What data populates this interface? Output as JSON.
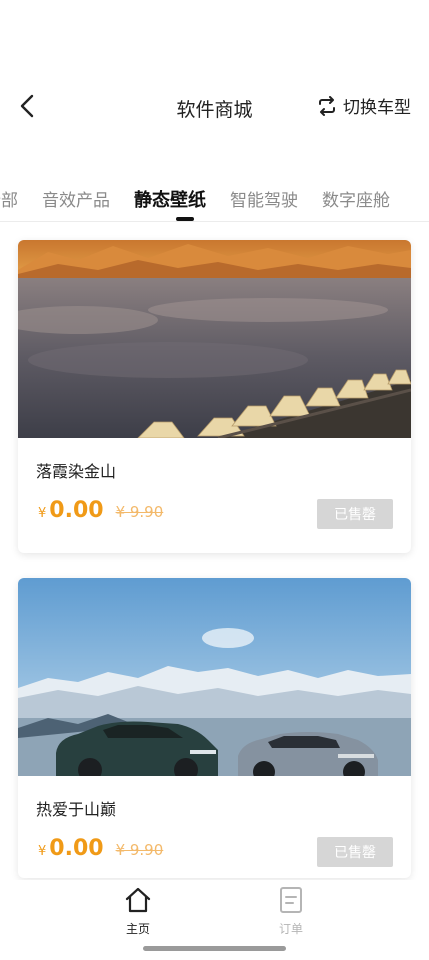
{
  "header": {
    "title": "软件商城",
    "switch_label": "切换车型"
  },
  "tabs": [
    {
      "label": "全部",
      "active": false
    },
    {
      "label": "音效产品",
      "active": false
    },
    {
      "label": "静态壁纸",
      "active": true
    },
    {
      "label": "智能驾驶",
      "active": false
    },
    {
      "label": "数字座舱",
      "active": false
    }
  ],
  "products": [
    {
      "name": "落霞染金山",
      "currency": "¥",
      "price": "0.00",
      "original_price": "¥ 9.90",
      "status": "已售罄"
    },
    {
      "name": "热爱于山巅",
      "currency": "¥",
      "price": "0.00",
      "original_price": "¥ 9.90",
      "status": "已售罄"
    }
  ],
  "nav": {
    "home_label": "主页",
    "orders_label": "订单"
  },
  "colors": {
    "accent": "#f09a17",
    "sold_out_bg": "#d6d6d6"
  }
}
